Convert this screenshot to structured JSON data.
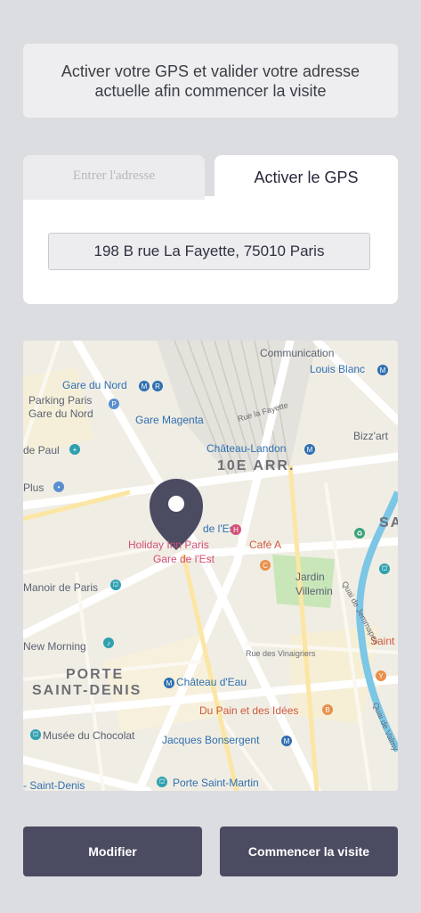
{
  "banner": {
    "text": "Activer votre GPS et valider votre adresse actuelle afin commencer la visite"
  },
  "tabs": {
    "address": "Entrer l'adresse",
    "gps": "Activer le GPS"
  },
  "address": {
    "value": "198 B rue La Fayette, 75010 Paris"
  },
  "map": {
    "labels": {
      "communication": "Communication",
      "louis_blanc": "Louis Blanc",
      "gare_du_nord": "Gare du Nord",
      "parking_1": "Parking Paris",
      "parking_2": "Gare du Nord",
      "gare_magenta": "Gare Magenta",
      "rue_la_fayette": "Rue la Fayette",
      "bizzart": "Bizz'art",
      "de_paul": "de Paul",
      "chateau_landon": "Château-Landon",
      "arr_10": "10E ARR.",
      "plus": "Plus",
      "gare_est": "de l'Est",
      "holiday_1": "Holiday Inn Paris",
      "holiday_2": "Gare de l'Est",
      "cafe_a": "Café A",
      "jardin_1": "Jardin",
      "jardin_2": "Villemin",
      "quai_jemmapes": "Quai de Jemmapes",
      "manoir": "Manoir de Paris",
      "new_morning": "New Morning",
      "saint": "Saint",
      "rue_vinaigriers": "Rue des Vinaigriers",
      "porte_1": "PORTE",
      "porte_2": "SAINT-DENIS",
      "chateau_eau": "Château d'Eau",
      "du_pain": "Du Pain et des Idées",
      "quai_valmy": "Quai de Valmy",
      "musee": "Musée du Chocolat",
      "jacques": "Jacques Bonsergent",
      "saint_denis": "- Saint-Denis",
      "porte_st_martin": "Porte Saint-Martin",
      "sai": "SAI"
    }
  },
  "buttons": {
    "modify": "Modifier",
    "start": "Commencer la visite"
  }
}
